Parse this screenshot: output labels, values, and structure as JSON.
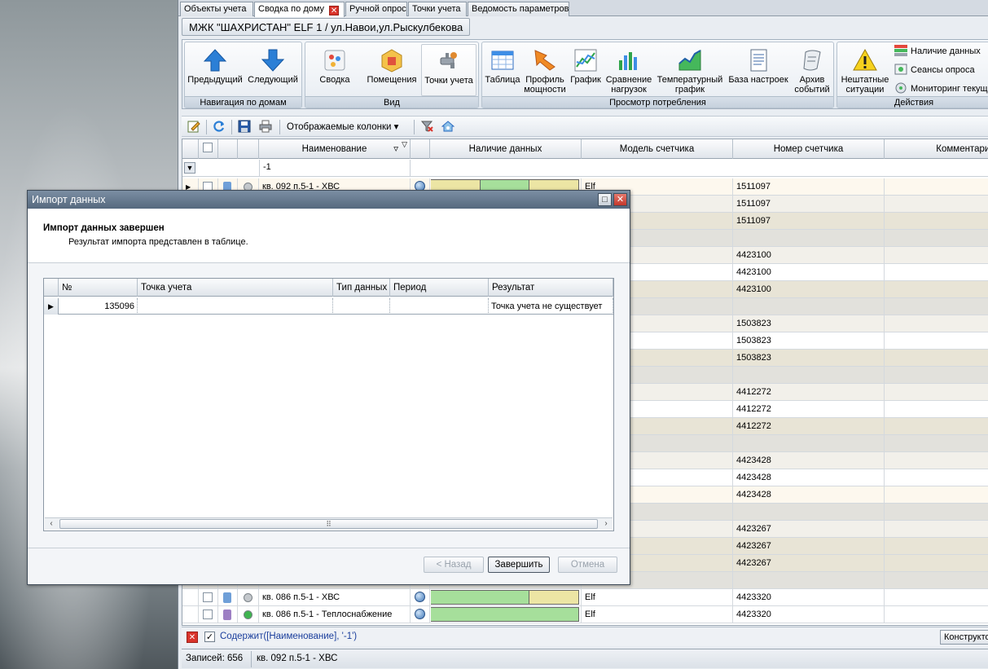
{
  "doc_tabs": [
    {
      "label": "Объекты учета"
    },
    {
      "label": "Сводка по дому"
    },
    {
      "label": "Ручной опрос"
    },
    {
      "label": "Точки учета"
    },
    {
      "label": "Ведомость параметров"
    }
  ],
  "tab_close_glyph": "✕",
  "object_title": "МЖК \"ШАХРИСТАН\" ELF 1 / ул.Навои,ул.Рыскулбекова",
  "ribbon": {
    "nav_group": {
      "label": "Навигация по домам",
      "prev": "Предыдущий",
      "next": "Следующий"
    },
    "view_group": {
      "label": "Вид",
      "summary": "Сводка",
      "rooms": "Помещения",
      "points": "Точки учета"
    },
    "consumption_group": {
      "label": "Просмотр потребления",
      "table": "Таблица",
      "power_profile_l1": "Профиль",
      "power_profile_l2": "мощности",
      "chart": "График",
      "load_cmp_l1": "Сравнение",
      "load_cmp_l2": "нагрузок",
      "temp_chart_l1": "Температурный",
      "temp_chart_l2": "график",
      "settings_db": "База настроек",
      "events_l1": "Архив",
      "events_l2": "событий"
    },
    "actions_group": {
      "label": "Действия",
      "emergency_l1": "Нештатные",
      "emergency_l2": "ситуации",
      "data_presence": "Наличие данных",
      "sessions": "Сеансы опроса",
      "monitoring": "Мониторинг текущих"
    }
  },
  "toolbar": {
    "columns_label": "Отображаемые колонки"
  },
  "grid": {
    "headers": {
      "name": "Наименование",
      "data_presence": "Наличие данных",
      "meter_model": "Модель счетчика",
      "meter_number": "Номер счетчика",
      "comment": "Комментарий"
    },
    "filter_value": "-1",
    "rows": [
      {
        "name": "кв. 092 п.5-1 - ХВС",
        "model": "Elf",
        "number": "1511097",
        "style": "cream"
      },
      {
        "name": "",
        "model": "",
        "number": "1511097",
        "style": "alt"
      },
      {
        "name": "",
        "model": "",
        "number": "1511097",
        "style": "band"
      },
      {
        "name": "",
        "model": "",
        "number": "",
        "style": "group"
      },
      {
        "name": "",
        "model": "",
        "number": "4423100",
        "style": "alt"
      },
      {
        "name": "",
        "model": "",
        "number": "4423100",
        "style": "plain"
      },
      {
        "name": "",
        "model": "",
        "number": "4423100",
        "style": "band"
      },
      {
        "name": "",
        "model": "",
        "number": "",
        "style": "group"
      },
      {
        "name": "",
        "model": "",
        "number": "1503823",
        "style": "alt"
      },
      {
        "name": "",
        "model": "",
        "number": "1503823",
        "style": "plain"
      },
      {
        "name": "",
        "model": "",
        "number": "1503823",
        "style": "band"
      },
      {
        "name": "",
        "model": "",
        "number": "",
        "style": "group"
      },
      {
        "name": "",
        "model": "",
        "number": "4412272",
        "style": "alt"
      },
      {
        "name": "",
        "model": "",
        "number": "4412272",
        "style": "plain"
      },
      {
        "name": "",
        "model": "",
        "number": "4412272",
        "style": "band"
      },
      {
        "name": "",
        "model": "",
        "number": "",
        "style": "group"
      },
      {
        "name": "",
        "model": "",
        "number": "4423428",
        "style": "alt"
      },
      {
        "name": "",
        "model": "",
        "number": "4423428",
        "style": "plain"
      },
      {
        "name": "",
        "model": "",
        "number": "4423428",
        "style": "cream"
      },
      {
        "name": "",
        "model": "",
        "number": "",
        "style": "group"
      },
      {
        "name": "",
        "model": "",
        "number": "4423267",
        "style": "alt"
      },
      {
        "name": "",
        "model": "",
        "number": "4423267",
        "style": "band"
      },
      {
        "name": "",
        "model": "",
        "number": "4423267",
        "style": "band"
      },
      {
        "name": "",
        "model": "",
        "number": "",
        "style": "group"
      },
      {
        "name": "кв. 086 п.5-1 - ХВС",
        "model": "Elf",
        "number": "4423320",
        "style": "plain"
      },
      {
        "name": "кв. 086 п.5-1 - Теплоснабжение",
        "model": "Elf",
        "number": "4423320",
        "style": "plain"
      }
    ]
  },
  "filter_bar": {
    "expression": "Содержит([Наименование], '-1')",
    "check_glyph": "✓",
    "builder": "Конструктор"
  },
  "status": {
    "records": "Записей: 656",
    "current": "кв. 092 п.5-1 - ХВС"
  },
  "dialog": {
    "title": "Импорт данных",
    "header_title": "Импорт данных завершен",
    "header_subtitle": "Результат импорта представлен в таблице.",
    "columns": {
      "num": "№",
      "point": "Точка учета",
      "data_type": "Тип данных",
      "period": "Период",
      "result": "Результат"
    },
    "row": {
      "num": "135096",
      "point": "",
      "data_type": "",
      "period": "",
      "result": "Точка учета не существует"
    },
    "buttons": {
      "back": "< Назад",
      "finish": "Завершить",
      "cancel": "Отмена"
    }
  },
  "colors": {
    "green": "#a6df9b",
    "yellow": "#ece5a4",
    "accent": "#56697e"
  }
}
